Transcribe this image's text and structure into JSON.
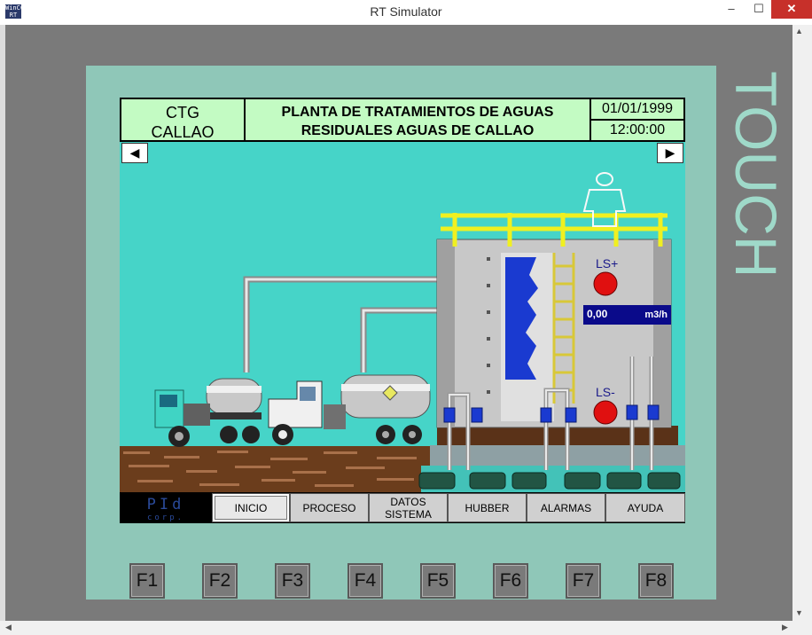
{
  "window": {
    "title": "RT Simulator",
    "icon_text": "WinCC RT",
    "minimize_glyph": "–",
    "maximize_glyph": "☐",
    "close_glyph": "✕"
  },
  "panel_brand": "TOUCH",
  "header": {
    "location_line1": "CTG",
    "location_line2": "CALLAO",
    "title_line1": "PLANTA DE TRATAMIENTOS DE AGUAS",
    "title_line2": "RESIDUALES AGUAS DE CALLAO",
    "date": "01/01/1999",
    "time": "12:00:00"
  },
  "nav": {
    "left_glyph": "◀",
    "right_glyph": "▶"
  },
  "tank": {
    "level_high_label": "LS+",
    "level_low_label": "LS-",
    "flow_value": "0,00",
    "flow_unit": "m3/h"
  },
  "logo": {
    "text_line1": "PId",
    "text_line2": "corp."
  },
  "menu": [
    {
      "label": "INICIO",
      "active": true
    },
    {
      "label": "PROCESO",
      "active": false
    },
    {
      "label": "DATOS\nSISTEMA",
      "active": false
    },
    {
      "label": "HUBBER",
      "active": false
    },
    {
      "label": "ALARMAS",
      "active": false
    },
    {
      "label": "AYUDA",
      "active": false
    }
  ],
  "function_keys": [
    "F1",
    "F2",
    "F3",
    "F4",
    "F5",
    "F6",
    "F7",
    "F8"
  ],
  "colors": {
    "screen_bg": "#46d4c8",
    "header_bg": "#c3fbc3",
    "panel_bg": "#8fc7b8",
    "level_indicator": "#e01010",
    "flow_box": "#0a0a8a",
    "handrail": "#f0f020"
  }
}
